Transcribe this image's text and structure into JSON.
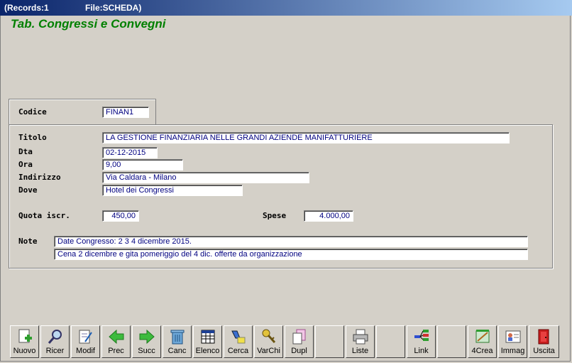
{
  "window": {
    "records": "(Records:1",
    "file": "File:SCHEDA)"
  },
  "heading": "Tab. Congressi e Convegni",
  "form": {
    "codice": {
      "label": "Codice",
      "value": "FINAN1"
    },
    "titolo": {
      "label": "Titolo",
      "value": "LA GESTIONE FINANZIARIA NELLE GRANDI AZIENDE MANIFATTURIERE"
    },
    "dta": {
      "label": "Dta",
      "value": "02-12-2015"
    },
    "ora": {
      "label": "Ora",
      "value": "9,00"
    },
    "indirizzo": {
      "label": "Indirizzo",
      "value": "Via Caldara - Milano"
    },
    "dove": {
      "label": "Dove",
      "value": "Hotel dei Congressi"
    },
    "quota": {
      "label": "Quota iscr.",
      "value": "450,00"
    },
    "spese": {
      "label": "Spese",
      "value": "4.000,00"
    },
    "note": {
      "label": "Note",
      "line1": "Date Congresso: 2 3 4 dicembre 2015.",
      "line2": "Cena 2 dicembre e gita pomeriggio del 4 dic. offerte da organizzazione"
    }
  },
  "toolbar": {
    "nuovo": "Nuovo",
    "ricer": "Ricer",
    "modif": "Modif",
    "prec": "Prec",
    "succ": "Succ",
    "canc": "Canc",
    "elenco": "Elenco",
    "cerca": "Cerca",
    "varchi": "VarChi",
    "dupl": "Dupl",
    "liste": "Liste",
    "link": "Link",
    "crea": "4Crea",
    "immag": "Immag",
    "uscita": "Uscita"
  }
}
